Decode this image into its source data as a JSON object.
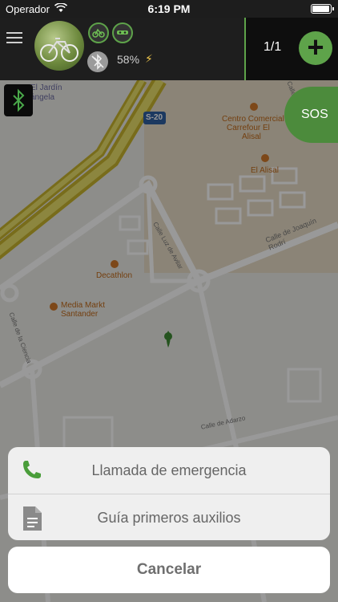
{
  "statusbar": {
    "carrier": "Operador",
    "time": "6:19 PM",
    "battery_level": 0.95
  },
  "header": {
    "battery_percent": "58%",
    "counter": "1/1",
    "add_symbol": "+"
  },
  "map": {
    "labels": {
      "jardin": "El Jardín",
      "angela": "ángela",
      "s20": "S-20",
      "centro": "Centro Comercial",
      "carrefour": "Carrefour El",
      "alisal": "Alisal",
      "el_alisal": "El Alisal",
      "luz": "Calle Luz de Avilar",
      "joaquin": "Calle de Joaquín Rodrí",
      "decathlon": "Decathlon",
      "media": "Media Markt",
      "santander": "Santander",
      "ciencia": "Calle de la Ciencia",
      "adarzo": "Calle de Adarzo",
      "ju": "Calle Ju"
    },
    "sos": "SOS"
  },
  "sheet": {
    "items": [
      {
        "label": "Llamada de emergencia",
        "icon": "phone-icon"
      },
      {
        "label": "Guía primeros auxilios",
        "icon": "document-icon"
      }
    ],
    "cancel": "Cancelar"
  },
  "colors": {
    "accent": "#5ea34a",
    "sos": "#4c8b3c"
  }
}
